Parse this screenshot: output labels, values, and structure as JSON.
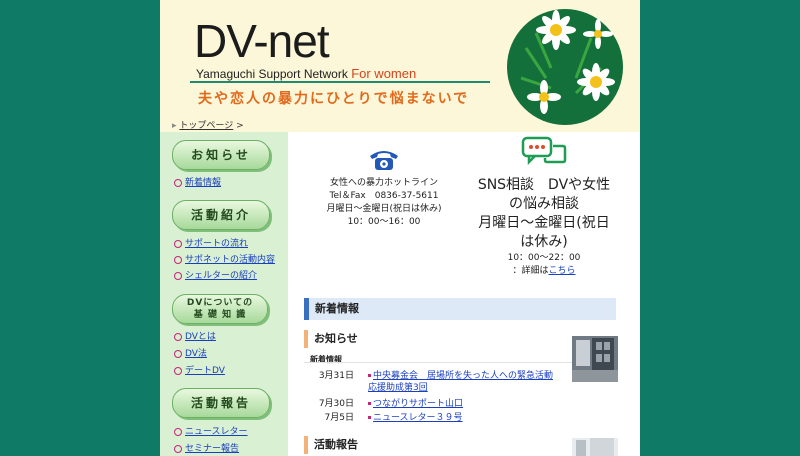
{
  "header": {
    "logo": "DV-net",
    "subtitle_main": "Yamaguchi Support Network ",
    "subtitle_accent": "For women",
    "tagline": "夫や恋人の暴力にひとりで悩まないで",
    "breadcrumb_home": "トップページ",
    "breadcrumb_sep": " >"
  },
  "sidebar": {
    "sections": [
      {
        "title": "お知らせ",
        "links": [
          "新着情報"
        ]
      },
      {
        "title": "活動紹介",
        "links": [
          "サポートの流れ",
          "サポネットの活動内容",
          "シェルターの紹介"
        ]
      },
      {
        "title_line1": "DVについての",
        "title_line2": "基 礎 知 識",
        "links": [
          "DVとは",
          "DV法",
          "デートDV"
        ]
      },
      {
        "title": "活動報告",
        "links": [
          "ニュースレター",
          "セミナー報告"
        ]
      }
    ]
  },
  "hotline": {
    "title": "女性への暴力ホットライン",
    "tel": "Tel＆Fax　0836-37-5611",
    "days": "月曜日～金曜日(祝日は休み)",
    "hours": "10：00～16：00"
  },
  "sns": {
    "line1": "SNS相談　DVや女性",
    "line2": "の悩み相談",
    "line3": "月曜日～金曜日(祝日",
    "line4": "は休み)",
    "hours": "10：00～22：00",
    "detail_prefix": "：詳細は",
    "detail_link": "こちら"
  },
  "main": {
    "section_title": "新着情報",
    "notice_title": "お知らせ",
    "news_label": "新着情報",
    "news": [
      {
        "date": "3月31日",
        "text": "中央募金会　居場所を失った人への緊急活動応援助成第3回"
      },
      {
        "date": "7月30日",
        "text": "つながりサポート山口"
      },
      {
        "date": "7月5日",
        "text": "ニュースレター３９号"
      }
    ],
    "report_title": "活動報告"
  },
  "colors": {
    "background": "#0f7a66",
    "header_bg": "#fbf7d8",
    "sidebar_bg": "#d9f0d2",
    "tagline": "#e26a1c",
    "link": "#1a3fbf",
    "section_accent": "#3b6fc0"
  }
}
